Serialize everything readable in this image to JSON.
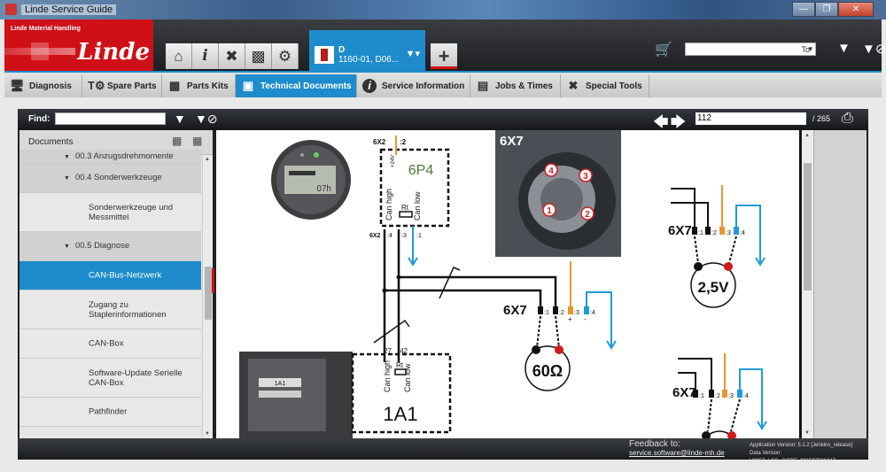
{
  "window": {
    "title": "Linde Service Guide",
    "controls": [
      "minimize",
      "restore",
      "close"
    ]
  },
  "header": {
    "brand_sub": "Linde Material Handling",
    "brand": "Linde",
    "nav_icons": [
      "home-icon",
      "info-icon",
      "tools-icon",
      "toolbox-icon",
      "gear-icon"
    ],
    "vehicle": {
      "line1": "D",
      "line2": "1160-01,  D06..."
    },
    "add_label": "+",
    "search": {
      "value": "",
      "dropdown": "To"
    }
  },
  "tabs": [
    {
      "label": "Diagnosis",
      "icon": "monitor-icon",
      "active": false
    },
    {
      "label": "Spare Parts",
      "icon": "spare-parts-icon",
      "active": false
    },
    {
      "label": "Parts Kits",
      "icon": "parts-kit-icon",
      "active": false
    },
    {
      "label": "Technical Documents",
      "icon": "document-icon",
      "active": true
    },
    {
      "label": "Service Information",
      "icon": "info-icon",
      "active": false
    },
    {
      "label": "Jobs & Times",
      "icon": "clock-doc-icon",
      "active": false
    },
    {
      "label": "Special Tools",
      "icon": "tools-icon",
      "active": false
    }
  ],
  "panel": {
    "find_label": "Find:",
    "find_value": "",
    "page_current": "112",
    "page_total": "/ 265",
    "documents_title": "Documents",
    "tree": [
      {
        "label": "00.3 Anzugsdrehmomente",
        "type": "grp",
        "clipped": true
      },
      {
        "label": "00.4 Sonderwerkzeuge",
        "type": "grp"
      },
      {
        "label": "Sonderwerkzeuge und Messmittel",
        "type": "leaf"
      },
      {
        "label": "00.5 Diagnose",
        "type": "grp"
      },
      {
        "label": "CAN-Bus-Netzwerk",
        "type": "sel"
      },
      {
        "label": "Zugang zu Staplerinformationen",
        "type": "leaf"
      },
      {
        "label": "CAN-Box",
        "type": "leaf"
      },
      {
        "label": "Software-Update Serielle CAN-Box",
        "type": "leaf"
      },
      {
        "label": "Pathfinder",
        "type": "leaf"
      }
    ]
  },
  "diagram": {
    "module_top": "6P4",
    "module_bottom": "1A1",
    "photo_label_1A1": "1A1",
    "photo_label_6X7": "6X7",
    "display_reading": "07h",
    "conn_6x2_top": "6X2",
    "pin_top": ":2",
    "supply_label": "+24V",
    "can_high": "Can high",
    "can_low": "Can low",
    "rt": "Rt",
    "conn_6x2_bottom": "6X2",
    "pins_6x2": [
      ":4",
      ":3",
      ":1"
    ],
    "pins_1a1": [
      "27",
      ":42"
    ],
    "connector": "6X7",
    "pins_6x7": [
      ":1",
      ":2",
      ":3",
      ":4"
    ],
    "photo_pins": [
      "4",
      "3",
      "1",
      "2"
    ],
    "polarity": [
      "+",
      "-"
    ],
    "meter_resistance": "60Ω",
    "meter_voltage": "2,5V",
    "colors": {
      "orange": "#e8952e",
      "blue": "#1f9ad6",
      "red": "#d11a1a",
      "black": "#111111"
    }
  },
  "footer": {
    "feedback_label": "Feedback to:",
    "feedback_email": "service.software@linde-mh.de",
    "app_version": "Application Version: 5.1.2 [Jenkins_release]",
    "data_version": "Data Version: U0053_LSG_CORE_201507201047"
  }
}
